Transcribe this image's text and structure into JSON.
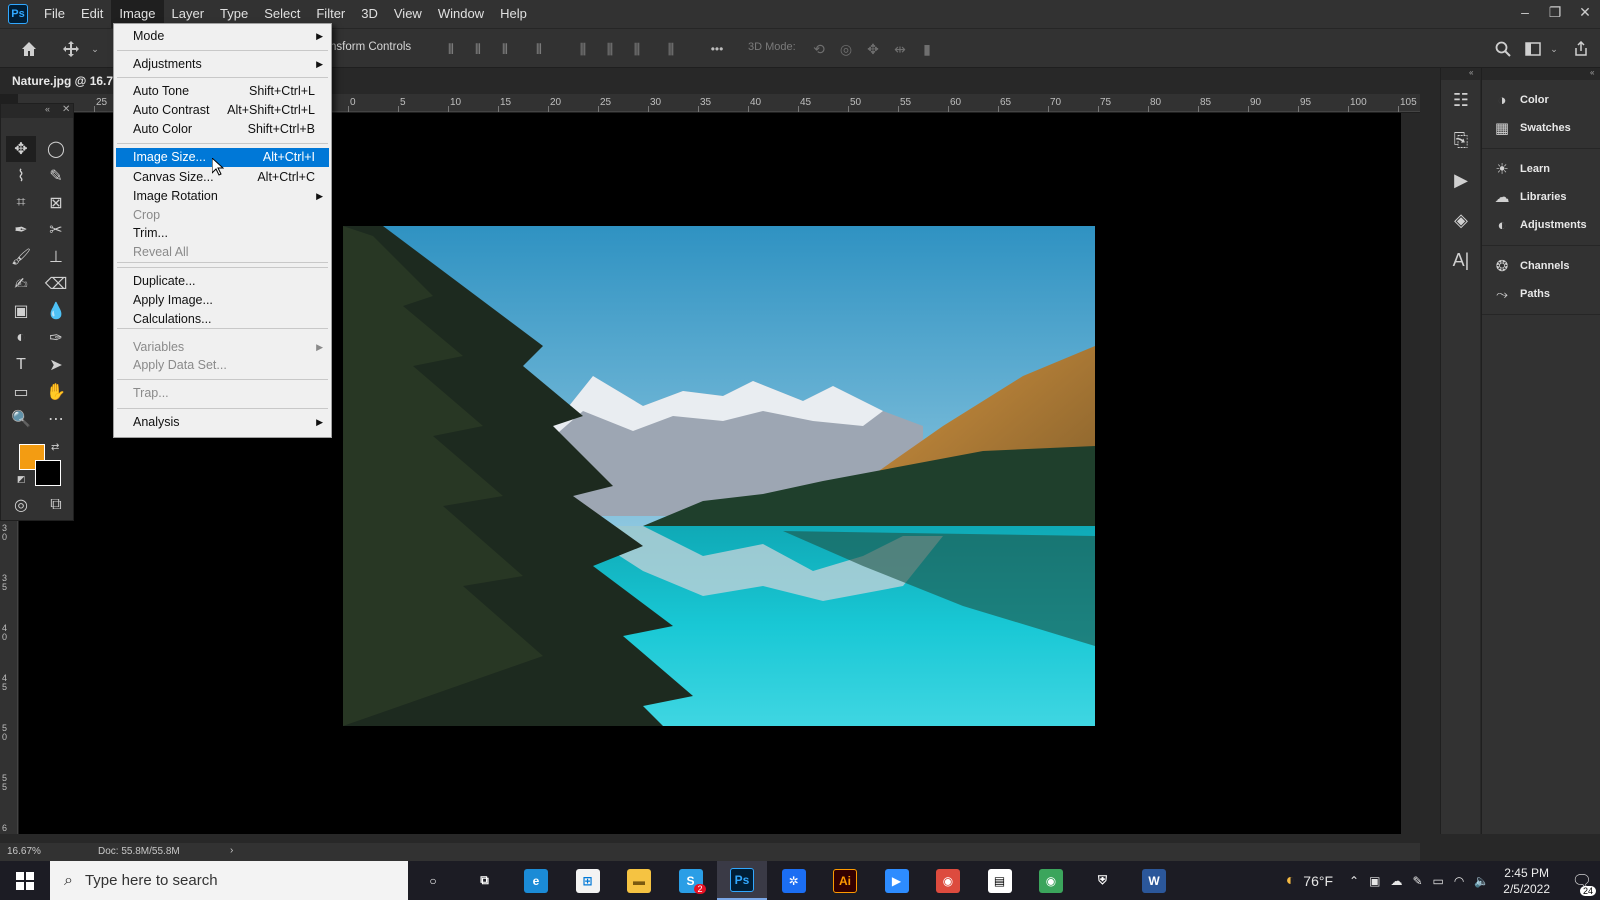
{
  "app": {
    "logo": "Ps"
  },
  "menubar": {
    "items": [
      "File",
      "Edit",
      "Image",
      "Layer",
      "Type",
      "Select",
      "Filter",
      "3D",
      "View",
      "Window",
      "Help"
    ],
    "active": "Image"
  },
  "window_controls": {
    "minimize": "–",
    "restore": "❐",
    "close": "✕"
  },
  "options": {
    "transform_controls_label": "nsform Controls",
    "mode3d_label": "3D Mode:",
    "more": "•••"
  },
  "document": {
    "tab_label": "Nature.jpg @ 16.7"
  },
  "ruler": {
    "h_labels": [
      "25",
      "0",
      "5",
      "10",
      "15",
      "20",
      "25",
      "30",
      "35",
      "40",
      "45",
      "50",
      "55",
      "60",
      "65",
      "70",
      "75",
      "80",
      "85",
      "90",
      "95",
      "100",
      "105"
    ],
    "v_labels": [
      "3 0",
      "3 5",
      "4 0",
      "4 5",
      "5 0",
      "5 5",
      "6"
    ]
  },
  "status": {
    "zoom": "16.67%",
    "doc": "Doc: 55.8M/55.8M",
    "arrow": "›"
  },
  "image_menu": {
    "items": [
      {
        "label": "Mode",
        "submenu": true
      },
      {
        "label": "Adjustments",
        "submenu": true
      },
      {
        "label": "Auto Tone",
        "shortcut": "Shift+Ctrl+L"
      },
      {
        "label": "Auto Contrast",
        "shortcut": "Alt+Shift+Ctrl+L"
      },
      {
        "label": "Auto Color",
        "shortcut": "Shift+Ctrl+B"
      },
      {
        "label": "Image Size...",
        "shortcut": "Alt+Ctrl+I",
        "highlighted": true
      },
      {
        "label": "Canvas Size...",
        "shortcut": "Alt+Ctrl+C"
      },
      {
        "label": "Image Rotation",
        "submenu": true
      },
      {
        "label": "Crop",
        "disabled": true
      },
      {
        "label": "Trim..."
      },
      {
        "label": "Reveal All",
        "disabled": true
      },
      {
        "label": "Duplicate..."
      },
      {
        "label": "Apply Image..."
      },
      {
        "label": "Calculations..."
      },
      {
        "label": "Variables",
        "submenu": true,
        "disabled": true
      },
      {
        "label": "Apply Data Set...",
        "disabled": true
      },
      {
        "label": "Trap...",
        "disabled": true
      },
      {
        "label": "Analysis",
        "submenu": true
      }
    ]
  },
  "panels": {
    "groups": [
      [
        {
          "icon": "color-icon",
          "label": "Color"
        },
        {
          "icon": "swatches-icon",
          "label": "Swatches"
        }
      ],
      [
        {
          "icon": "learn-icon",
          "label": "Learn"
        },
        {
          "icon": "libraries-icon",
          "label": "Libraries"
        },
        {
          "icon": "adjustments-icon",
          "label": "Adjustments"
        }
      ],
      [
        {
          "icon": "channels-icon",
          "label": "Channels"
        },
        {
          "icon": "paths-icon",
          "label": "Paths"
        }
      ]
    ]
  },
  "colors": {
    "foreground": "#f39c12",
    "background": "#000000",
    "menu_highlight": "#0078d7",
    "ps_blue": "#31a8ff"
  },
  "taskbar": {
    "search_placeholder": "Type here to search",
    "weather": "76°F",
    "time": "2:45 PM",
    "date": "2/5/2022",
    "notification_count": "24",
    "skype_badge": "2",
    "apps": [
      {
        "name": "cortana-icon",
        "label": "○"
      },
      {
        "name": "task-view-icon",
        "label": "⧉"
      },
      {
        "name": "edge-icon",
        "label": "e"
      },
      {
        "name": "store-icon",
        "label": "⊞"
      },
      {
        "name": "file-explorer-icon",
        "label": "▬"
      },
      {
        "name": "skype-icon",
        "label": "S"
      },
      {
        "name": "photoshop-icon",
        "label": "Ps"
      },
      {
        "name": "app-blue-icon",
        "label": "✲"
      },
      {
        "name": "illustrator-icon",
        "label": "Ai"
      },
      {
        "name": "zoom-icon",
        "label": "▶"
      },
      {
        "name": "chrome-icon",
        "label": "◉"
      },
      {
        "name": "file-icon",
        "label": "▤"
      },
      {
        "name": "chrome-profile-icon",
        "label": "◉"
      },
      {
        "name": "security-icon",
        "label": "⛨"
      },
      {
        "name": "word-icon",
        "label": "W"
      }
    ]
  }
}
